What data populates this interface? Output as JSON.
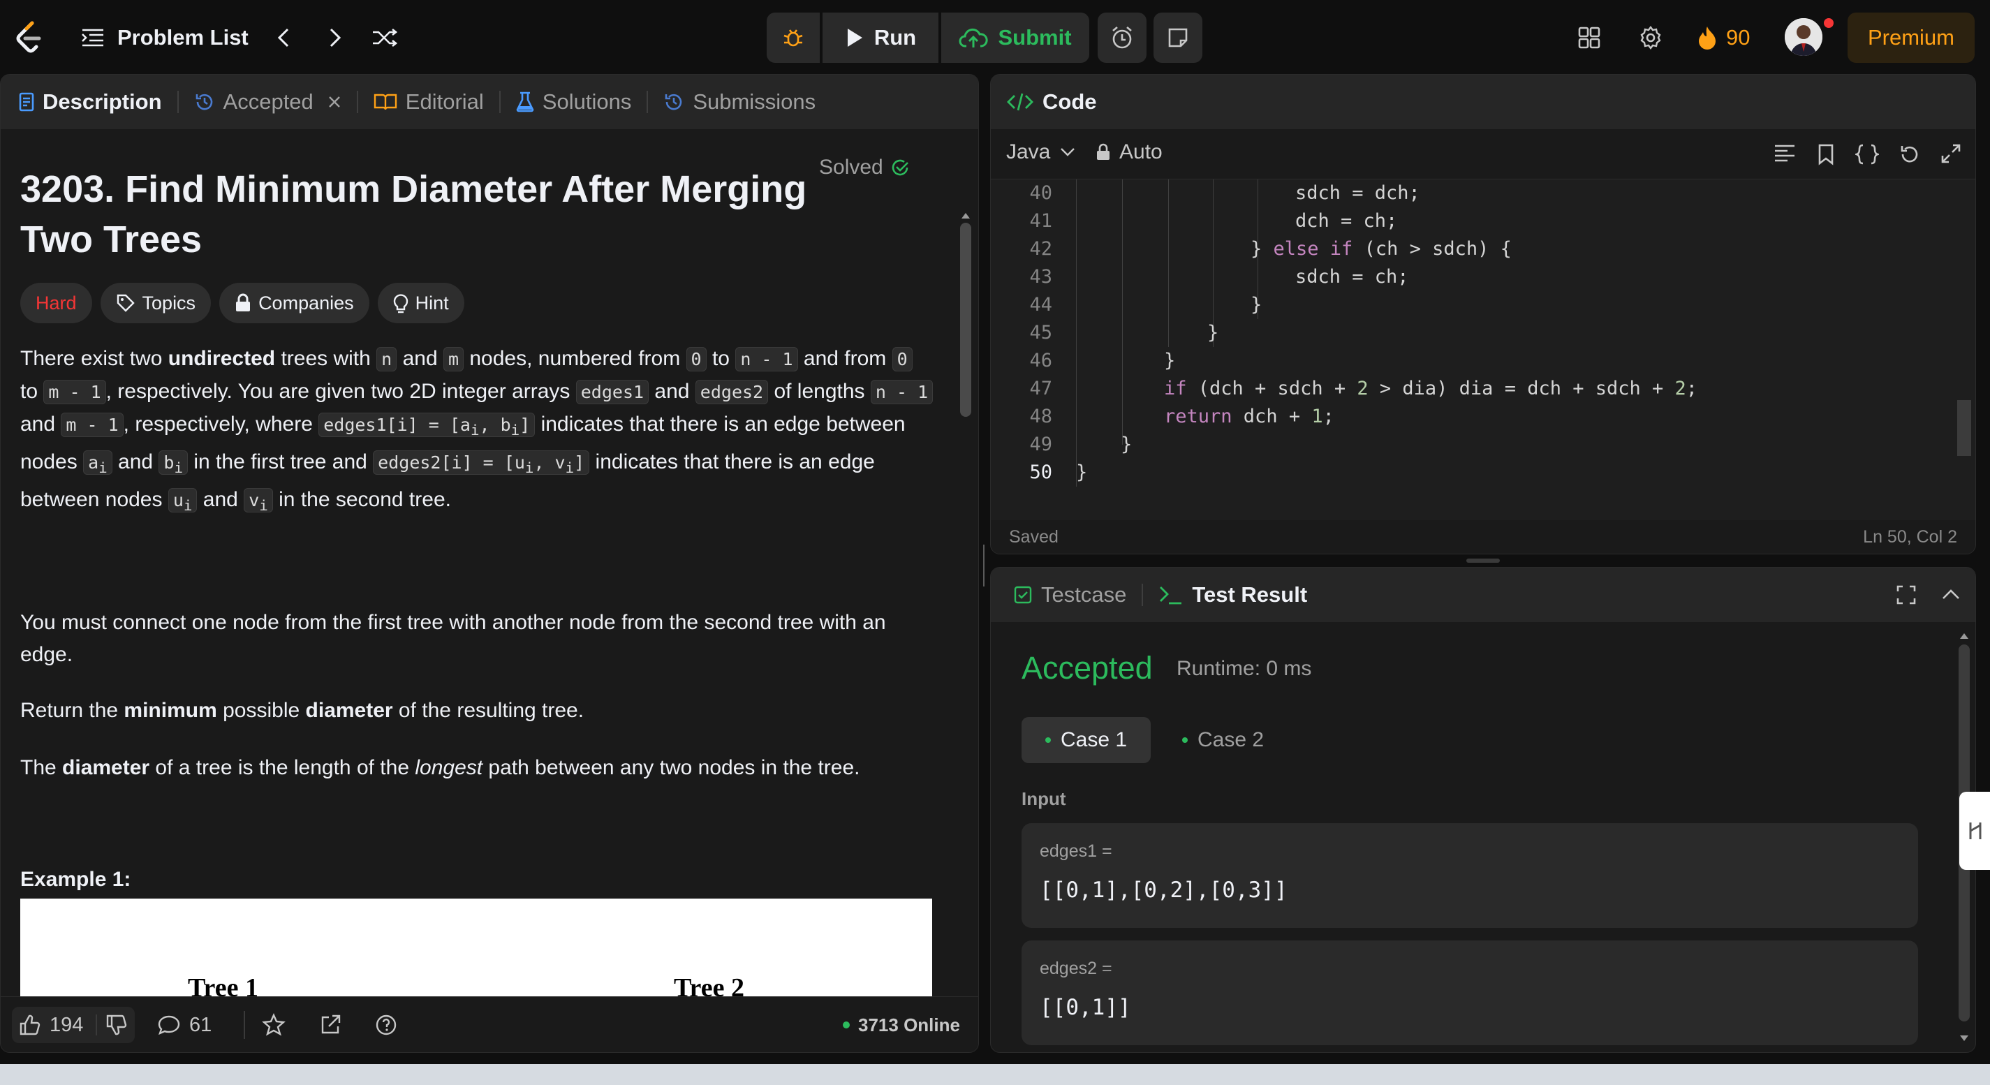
{
  "nav": {
    "problem_list": "Problem List",
    "run": "Run",
    "submit": "Submit",
    "streak": "90",
    "premium": "Premium"
  },
  "left_tabs": [
    {
      "label": "Description",
      "icon": "document-icon",
      "active": true
    },
    {
      "label": "Accepted",
      "icon": "history-icon",
      "closable": true
    },
    {
      "label": "Editorial",
      "icon": "book-icon"
    },
    {
      "label": "Solutions",
      "icon": "flask-icon"
    },
    {
      "label": "Submissions",
      "icon": "history-icon"
    }
  ],
  "problem": {
    "title": "3203. Find Minimum Diameter After Merging Two Trees",
    "status": "Solved",
    "difficulty": "Hard",
    "chips": [
      "Topics",
      "Companies",
      "Hint"
    ],
    "p2": "You must connect one node from the first tree with another node from the second tree with an edge.",
    "p3_a": "Return the ",
    "p3_b": "minimum",
    "p3_c": " possible ",
    "p3_d": "diameter",
    "p3_e": " of the resulting tree.",
    "p4_a": "The ",
    "p4_b": "diameter",
    "p4_c": " of a tree is the length of the ",
    "p4_d": "longest",
    "p4_e": " path between any two nodes in the tree.",
    "example_heading": "Example 1:",
    "tree1": "Tree 1",
    "tree2": "Tree 2"
  },
  "footer": {
    "likes": "194",
    "comments": "61",
    "online": "3713 Online"
  },
  "code": {
    "header": "Code",
    "language": "Java",
    "mode": "Auto",
    "status": "Saved",
    "cursor": "Ln 50, Col 2",
    "lines": [
      {
        "n": "40",
        "t": "                sdch = dch;"
      },
      {
        "n": "41",
        "t": "                dch = ch;"
      },
      {
        "n": "42",
        "t": "            } else if (ch > sdch) {"
      },
      {
        "n": "43",
        "t": "                sdch = ch;"
      },
      {
        "n": "44",
        "t": "            }"
      },
      {
        "n": "45",
        "t": "        }"
      },
      {
        "n": "46",
        "t": "    }"
      },
      {
        "n": "47",
        "t": "    if (dch + sdch + 2 > dia) dia = dch + sdch + 2;"
      },
      {
        "n": "48",
        "t": "    return dch + 1;"
      },
      {
        "n": "49",
        "t": "  }"
      },
      {
        "n": "50",
        "t": "}"
      }
    ]
  },
  "result": {
    "tab_testcase": "Testcase",
    "tab_result": "Test Result",
    "verdict": "Accepted",
    "runtime": "Runtime: 0 ms",
    "cases": [
      "Case 1",
      "Case 2"
    ],
    "input_label": "Input",
    "inputs": [
      {
        "name": "edges1 =",
        "value": "[[0,1],[0,2],[0,3]]"
      },
      {
        "name": "edges2 =",
        "value": "[[0,1]]"
      }
    ]
  }
}
